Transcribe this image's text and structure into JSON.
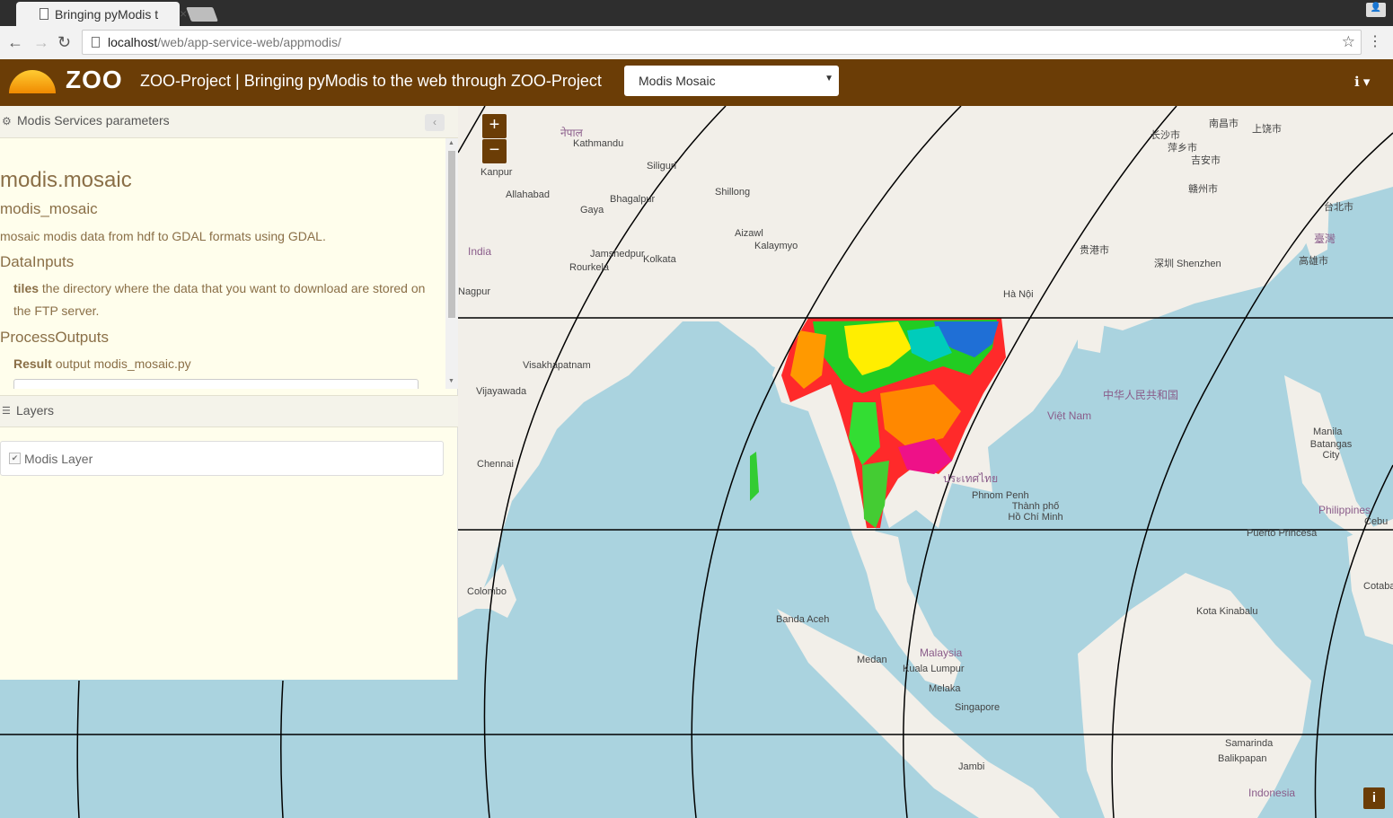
{
  "browser": {
    "tab_title": "Bringing pyModis t",
    "tab_close": "×",
    "url_host": "localhost",
    "url_path": "/web/app-service-web/appmodis/",
    "back": "←",
    "forward": "→",
    "reload": "↻",
    "star": "☆",
    "menu": "⋮",
    "profile": "👤"
  },
  "header": {
    "logo": "ZOO",
    "title": "ZOO-Project | Bringing pyModis to the web through ZOO-Project",
    "service_selected": "Modis Mosaic",
    "info_label": "ℹ ▾",
    "brand_color": "#6b3d06"
  },
  "panel": {
    "title": "Modis Services parameters",
    "collapse_icon": "‹",
    "process": {
      "title": "modis.mosaic",
      "identifier": "modis_mosaic",
      "description": "mosaic modis data from hdf to GDAL formats using GDAL.",
      "inputs_heading": "DataInputs",
      "input_name": "tiles",
      "input_desc": "the directory where the data that you want to download are stored on the FTP server.",
      "outputs_heading": "ProcessOutputs",
      "output_name": "Result",
      "output_desc": "output modis_mosaic.py"
    }
  },
  "layers": {
    "title": "Layers",
    "items": [
      {
        "label": "Modis Layer",
        "checked": true
      }
    ]
  },
  "map": {
    "zoom_in": "+",
    "zoom_out": "−",
    "attribution": "i",
    "labels": [
      {
        "text": "Kathmandu"
      },
      {
        "text": "नेपाल"
      },
      {
        "text": "Siliguri"
      },
      {
        "text": "Kanpur"
      },
      {
        "text": "Allahabad"
      },
      {
        "text": "Gaya"
      },
      {
        "text": "Bhagalpur"
      },
      {
        "text": "Shillong"
      },
      {
        "text": "India"
      },
      {
        "text": "Jamshedpur"
      },
      {
        "text": "Kolkata"
      },
      {
        "text": "Aizawl"
      },
      {
        "text": "Kalaymyo"
      },
      {
        "text": "Rourkela"
      },
      {
        "text": "Nagpur"
      },
      {
        "text": "Visakhapatnam"
      },
      {
        "text": "Vijayawada"
      },
      {
        "text": "Chennai"
      },
      {
        "text": "Colombo"
      },
      {
        "text": "Hà Nội"
      },
      {
        "text": "Việt Nam"
      },
      {
        "text": "中华人民共和国"
      },
      {
        "text": "贵港市"
      },
      {
        "text": "深圳 Shenzhen"
      },
      {
        "text": "高雄市"
      },
      {
        "text": "臺灣"
      },
      {
        "text": "Manila"
      },
      {
        "text": "Batangas City"
      },
      {
        "text": "Philippines"
      },
      {
        "text": "Puerto Princesa"
      },
      {
        "text": "Phnom Penh"
      },
      {
        "text": "Thành phố Hồ Chí Minh"
      },
      {
        "text": "Banda Aceh"
      },
      {
        "text": "Medan"
      },
      {
        "text": "Malaysia"
      },
      {
        "text": "Kuala Lumpur"
      },
      {
        "text": "Melaka"
      },
      {
        "text": "Singapore"
      },
      {
        "text": "Kota Kinabalu"
      },
      {
        "text": "Samarinda"
      },
      {
        "text": "Balikpapan"
      },
      {
        "text": "Jambi"
      },
      {
        "text": "Indonesia"
      },
      {
        "text": "南昌市"
      },
      {
        "text": "上饶市"
      },
      {
        "text": "长沙市"
      },
      {
        "text": "萍乡市"
      },
      {
        "text": "吉安市"
      },
      {
        "text": "赣州市"
      },
      {
        "text": "台北市"
      },
      {
        "text": "ประเทศไทย"
      },
      {
        "text": "Cebu"
      },
      {
        "text": "Cotabato"
      }
    ]
  }
}
